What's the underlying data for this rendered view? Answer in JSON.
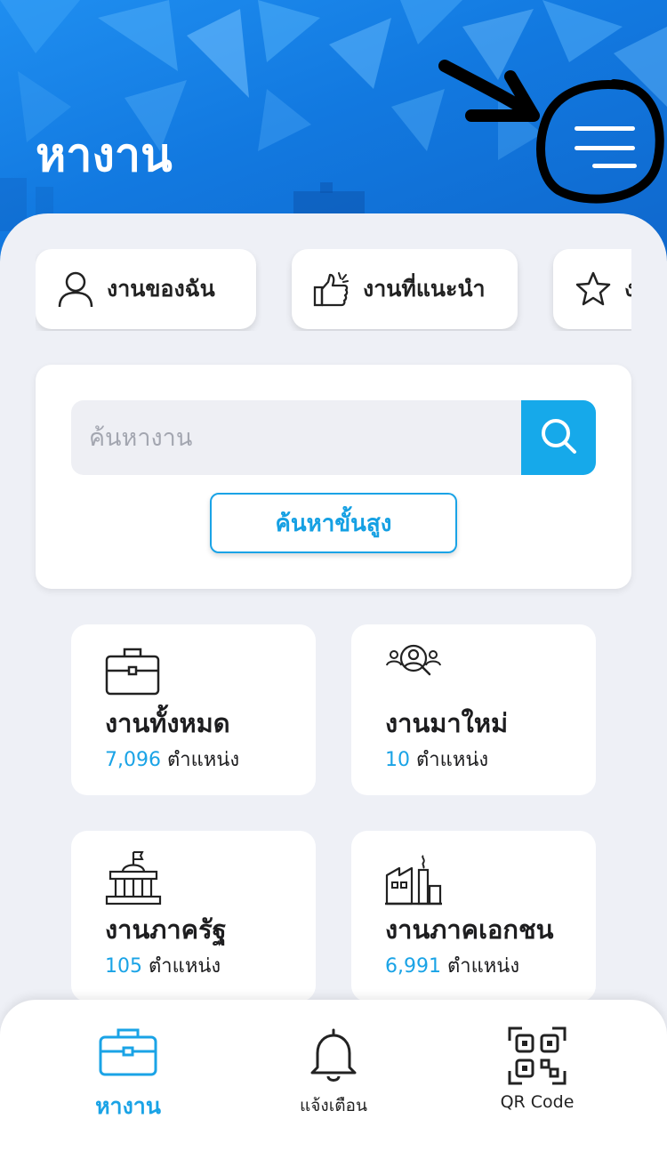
{
  "header": {
    "title": "หางาน",
    "menu_icon": "hamburger-menu-icon",
    "background_color": "#1279e0"
  },
  "chips": [
    {
      "label": "งานของฉัน",
      "icon": "user-icon"
    },
    {
      "label": "งานที่แนะนำ",
      "icon": "thumbs-up-icon"
    },
    {
      "label": "งานที่บันทึก",
      "icon": "star-icon"
    }
  ],
  "search": {
    "placeholder": "ค้นหางาน",
    "button_icon": "search-icon",
    "advanced_label": "ค้นหาขั้นสูง"
  },
  "categories": [
    {
      "title": "งานทั้งหมด",
      "count": "7,096",
      "unit": "ตำแหน่ง",
      "icon": "briefcase-icon"
    },
    {
      "title": "งานมาใหม่",
      "count": "10",
      "unit": "ตำแหน่ง",
      "icon": "people-search-icon"
    },
    {
      "title": "งานภาครัฐ",
      "count": "105",
      "unit": "ตำแหน่ง",
      "icon": "government-building-icon"
    },
    {
      "title": "งานภาคเอกชน",
      "count": "6,991",
      "unit": "ตำแหน่ง",
      "icon": "factory-icon"
    }
  ],
  "bottom_nav": [
    {
      "label": "หางาน",
      "icon": "briefcase-icon",
      "active": true
    },
    {
      "label": "แจ้งเตือน",
      "icon": "bell-icon",
      "active": false
    },
    {
      "label": "QR Code",
      "icon": "qr-code-icon",
      "active": false
    }
  ],
  "colors": {
    "accent": "#1aa3e6",
    "background": "#eef0f6"
  }
}
